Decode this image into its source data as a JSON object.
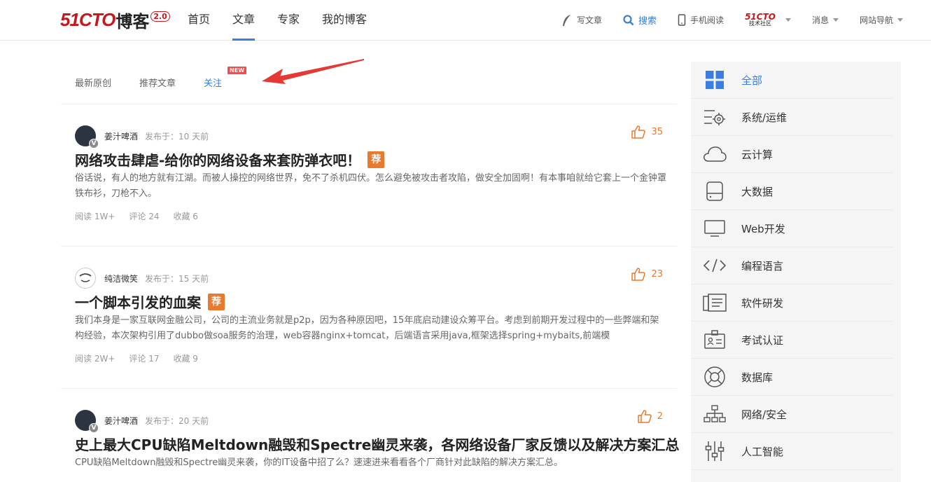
{
  "header": {
    "logo_main": "51CTO",
    "logo_blog": "博客",
    "logo_version": "2.0",
    "nav": [
      {
        "label": "首页"
      },
      {
        "label": "文章"
      },
      {
        "label": "专家"
      },
      {
        "label": "我的博客"
      }
    ],
    "active_nav": "文章",
    "write": "写文章",
    "search": "搜索",
    "mobile": "手机阅读",
    "community_logo_top": "51CTO",
    "community_logo_bottom": "技术社区",
    "messages": "消息",
    "site_nav": "网站导航"
  },
  "tabs": {
    "items": [
      {
        "label": "最新原创"
      },
      {
        "label": "推荐文章"
      },
      {
        "label": "关注"
      }
    ],
    "new_badge": "NEW"
  },
  "articles": [
    {
      "author": "姜汁啤酒",
      "published": "发布于：10 天前",
      "likes": "35",
      "title": "网络攻击肆虐-给你的网络设备来套防弹衣吧！",
      "recommended": "荐",
      "summary": "俗话说，有人的地方就有江湖。而被人操控的网络世界，免不了杀机四伏。怎么避免被攻击者攻陷，做安全加固啊！有本事咱就给它套上一个金钟罩铁布衫，刀枪不入。",
      "reads": "阅读 1W+",
      "comments": "评论 24",
      "favorites": "收藏 6"
    },
    {
      "author": "纯洁微笑",
      "published": "发布于：15 天前",
      "likes": "23",
      "title": "一个脚本引发的血案",
      "recommended": "荐",
      "summary": "我们本身是一家互联网金融公司，公司的主流业务就是p2p，因为各种原因吧，15年底启动建设众筹平台。考虑到前期开发过程中的一些弊端和架构经验，本次架构引用了dubbo做soa服务的治理，web容器nginx+tomcat，后端语言采用java,框架选择spring+mybaits,前端模",
      "reads": "阅读 2W+",
      "comments": "评论 17",
      "favorites": "收藏 9"
    },
    {
      "author": "姜汁啤酒",
      "published": "发布于：20 天前",
      "likes": "2",
      "title": "史上最大CPU缺陷Meltdown融毁和Spectre幽灵来袭，各网络设备厂家反馈以及解决方案汇总",
      "summary": "CPU缺陷Meltdown融毁和Spectre幽灵来袭，你的IT设备中招了么？速速进来看看各个厂商针对此缺陷的解决方案汇总。"
    }
  ],
  "sidebar": {
    "categories": [
      {
        "label": "全部",
        "icon": "grid-icon"
      },
      {
        "label": "系统/运维",
        "icon": "settings-list-icon"
      },
      {
        "label": "云计算",
        "icon": "cloud-icon"
      },
      {
        "label": "大数据",
        "icon": "harddisk-icon"
      },
      {
        "label": "Web开发",
        "icon": "monitor-icon"
      },
      {
        "label": "编程语言",
        "icon": "code-icon"
      },
      {
        "label": "软件研发",
        "icon": "document-list-icon"
      },
      {
        "label": "考试认证",
        "icon": "id-card-icon"
      },
      {
        "label": "数据库",
        "icon": "lifebuoy-icon"
      },
      {
        "label": "网络/安全",
        "icon": "network-icon"
      },
      {
        "label": "人工智能",
        "icon": "sliders-icon"
      }
    ]
  },
  "colors": {
    "accent": "#3b7de0",
    "brand_red": "#c8161d",
    "orange": "#e8792e"
  }
}
